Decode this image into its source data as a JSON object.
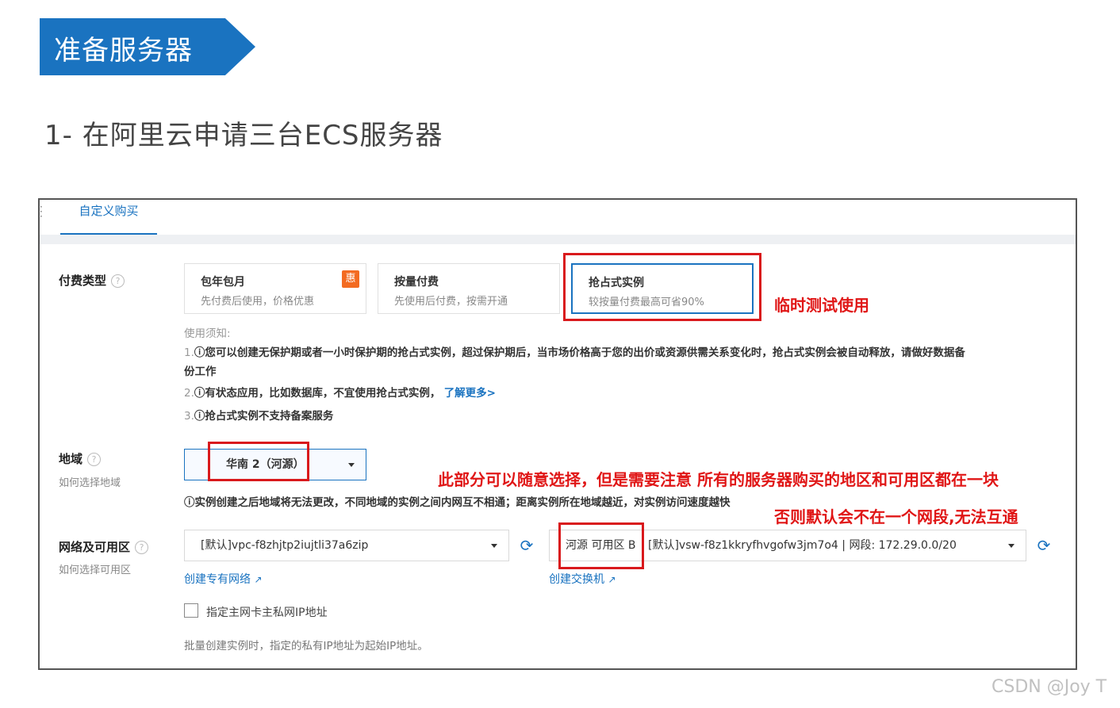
{
  "slide": {
    "title": "准备服务器",
    "subtitle": "1- 在阿里云申请三台ECS服务器"
  },
  "tabs": {
    "active": "自定义购买"
  },
  "billing": {
    "label": "付费类型",
    "options": [
      {
        "title": "包年包月",
        "desc": "先付费后使用，价格优惠",
        "badge": "惠"
      },
      {
        "title": "按量付费",
        "desc": "先使用后付费，按需开通"
      },
      {
        "title": "抢占式实例",
        "desc": "较按量付费最高可省90%"
      }
    ],
    "annotation": "临时测试使用"
  },
  "notice": {
    "heading": "使用须知:",
    "item1_num": "1.",
    "item1_text": "ⓘ您可以创建无保护期或者一小时保护期的抢占式实例，超过保护期后，当市场价格高于您的出价或资源供需关系变化时，抢占式实例会被自动释放，请做好数据备",
    "item1_cont": "份工作",
    "item2_num": "2.",
    "item2_text": "ⓘ有状态应用，比如数据库，不宜使用抢占式实例，",
    "item2_link": "了解更多>",
    "item3_num": "3.",
    "item3_text": "ⓘ抢占式实例不支持备案服务"
  },
  "region": {
    "label": "地域",
    "help": "如何选择地域",
    "value": "华南 2（河源）",
    "hint": "ⓘ实例创建之后地域将无法更改，不同地域的实例之间内网互不相通；距离实例所在地域越近，对实例访问速度越快",
    "annotation1": "此部分可以随意选择，但是需要注意 所有的服务器购买的地区和可用区都在一块",
    "annotation2": "否则默认会不在一个网段,无法互通"
  },
  "network": {
    "label": "网络及可用区",
    "help": "如何选择可用区",
    "vpc_value": "[默认]vpc-f8zhjtp2iujtli37a6zip",
    "vpc_link": "创建专有网络",
    "zone_value": "河源 可用区 B",
    "vsw_value": "[默认]vsw-f8z1kkryfhvgofw3jm7o4 | 网段: 172.29.0.0/20",
    "vsw_link": "创建交换机",
    "checkbox_label": "指定主网卡主私网IP地址",
    "bulk_hint": "批量创建实例时，指定的私有IP地址为起始IP地址。"
  },
  "watermark": "CSDN @Joy T",
  "colors": {
    "accent": "#1a73c0",
    "annotation": "#e01616",
    "badge": "#f36b21"
  }
}
